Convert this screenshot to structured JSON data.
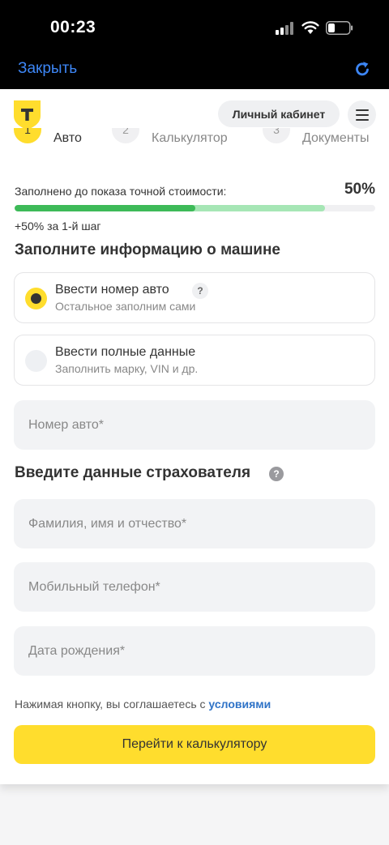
{
  "status_bar": {
    "time": "00:23"
  },
  "nav": {
    "close_label": "Закрыть"
  },
  "header": {
    "logo_letter": "Т",
    "cabinet_label": "Личный кабинет"
  },
  "steps": [
    {
      "number": "1",
      "label": "Авто"
    },
    {
      "number": "2",
      "label": "Калькулятор"
    },
    {
      "number": "3",
      "label": "Документы"
    }
  ],
  "progress": {
    "label": "Заполнено до показа точной стоимости:",
    "percent_label": "50%",
    "filled_fraction": 0.5,
    "with_step_fraction": 0.86,
    "bonus": "+50% за 1-й шаг"
  },
  "car_section": {
    "title": "Заполните информацию о машине",
    "options": [
      {
        "title": "Ввести номер авто",
        "subtitle": "Остальное заполним сами",
        "selected": true,
        "help": "?"
      },
      {
        "title": "Ввести полные данные",
        "subtitle": "Заполнить марку, VIN и др.",
        "selected": false
      }
    ],
    "car_number_placeholder": "Номер авто*"
  },
  "insurer_section": {
    "title": "Введите данные страхователя",
    "help": "?",
    "name_placeholder": "Фамилия, имя и отчество*",
    "phone_placeholder": "Мобильный телефон*",
    "birth_placeholder": "Дата рождения*"
  },
  "terms": {
    "text": "Нажимая кнопку, вы соглашаетесь с ",
    "link": "условиями"
  },
  "submit_label": "Перейти к калькулятору",
  "colors": {
    "accent": "#ffdd2d",
    "progress": "#3dba58",
    "progress_light": "#a6e6b5",
    "link": "#2f73c7",
    "ios_blue": "#3d86f5"
  }
}
